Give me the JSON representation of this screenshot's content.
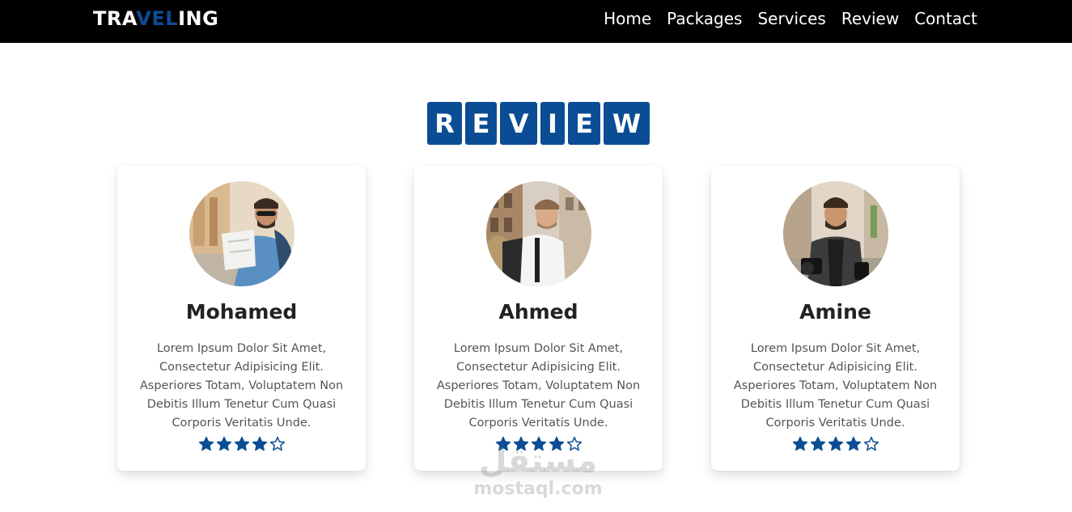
{
  "header": {
    "logo_part1": "TRA",
    "logo_part2": "VEL",
    "logo_part3": "ING",
    "nav": [
      "Home",
      "Packages",
      "Services",
      "Review",
      "Contact"
    ]
  },
  "section": {
    "title_letters": [
      "R",
      "E",
      "V",
      "I",
      "E",
      "W"
    ]
  },
  "reviews": [
    {
      "name": "Mohamed",
      "text": "Lorem Ipsum Dolor Sit Amet, Consectetur Adipisicing Elit. Asperiores Totam, Voluptatem Non Debitis Illum Tenetur Cum Quasi Corporis Veritatis Unde.",
      "rating": 4,
      "max_rating": 5
    },
    {
      "name": "Ahmed",
      "text": "Lorem Ipsum Dolor Sit Amet, Consectetur Adipisicing Elit. Asperiores Totam, Voluptatem Non Debitis Illum Tenetur Cum Quasi Corporis Veritatis Unde.",
      "rating": 4,
      "max_rating": 5
    },
    {
      "name": "Amine",
      "text": "Lorem Ipsum Dolor Sit Amet, Consectetur Adipisicing Elit. Asperiores Totam, Voluptatem Non Debitis Illum Tenetur Cum Quasi Corporis Veritatis Unde.",
      "rating": 4,
      "max_rating": 5
    }
  ],
  "watermark": {
    "arabic": "مستقل",
    "latin": "mostaql.com"
  },
  "colors": {
    "accent": "#0b4d94",
    "navbar_bg": "#000000",
    "star": "#0b4d94"
  },
  "icons": {
    "star_filled": "star-filled-icon",
    "star_empty": "star-empty-icon"
  }
}
